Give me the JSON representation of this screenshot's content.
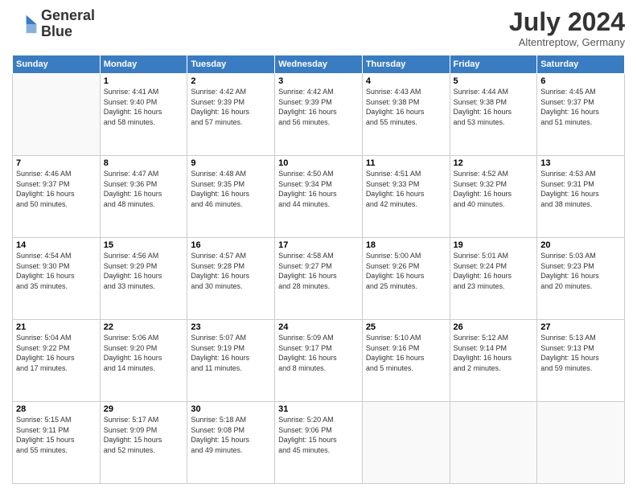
{
  "logo": {
    "line1": "General",
    "line2": "Blue"
  },
  "title": {
    "month_year": "July 2024",
    "location": "Altentreptow, Germany"
  },
  "weekdays": [
    "Sunday",
    "Monday",
    "Tuesday",
    "Wednesday",
    "Thursday",
    "Friday",
    "Saturday"
  ],
  "weeks": [
    [
      {
        "day": "",
        "info": ""
      },
      {
        "day": "1",
        "info": "Sunrise: 4:41 AM\nSunset: 9:40 PM\nDaylight: 16 hours\nand 58 minutes."
      },
      {
        "day": "2",
        "info": "Sunrise: 4:42 AM\nSunset: 9:39 PM\nDaylight: 16 hours\nand 57 minutes."
      },
      {
        "day": "3",
        "info": "Sunrise: 4:42 AM\nSunset: 9:39 PM\nDaylight: 16 hours\nand 56 minutes."
      },
      {
        "day": "4",
        "info": "Sunrise: 4:43 AM\nSunset: 9:38 PM\nDaylight: 16 hours\nand 55 minutes."
      },
      {
        "day": "5",
        "info": "Sunrise: 4:44 AM\nSunset: 9:38 PM\nDaylight: 16 hours\nand 53 minutes."
      },
      {
        "day": "6",
        "info": "Sunrise: 4:45 AM\nSunset: 9:37 PM\nDaylight: 16 hours\nand 51 minutes."
      }
    ],
    [
      {
        "day": "7",
        "info": "Sunrise: 4:46 AM\nSunset: 9:37 PM\nDaylight: 16 hours\nand 50 minutes."
      },
      {
        "day": "8",
        "info": "Sunrise: 4:47 AM\nSunset: 9:36 PM\nDaylight: 16 hours\nand 48 minutes."
      },
      {
        "day": "9",
        "info": "Sunrise: 4:48 AM\nSunset: 9:35 PM\nDaylight: 16 hours\nand 46 minutes."
      },
      {
        "day": "10",
        "info": "Sunrise: 4:50 AM\nSunset: 9:34 PM\nDaylight: 16 hours\nand 44 minutes."
      },
      {
        "day": "11",
        "info": "Sunrise: 4:51 AM\nSunset: 9:33 PM\nDaylight: 16 hours\nand 42 minutes."
      },
      {
        "day": "12",
        "info": "Sunrise: 4:52 AM\nSunset: 9:32 PM\nDaylight: 16 hours\nand 40 minutes."
      },
      {
        "day": "13",
        "info": "Sunrise: 4:53 AM\nSunset: 9:31 PM\nDaylight: 16 hours\nand 38 minutes."
      }
    ],
    [
      {
        "day": "14",
        "info": "Sunrise: 4:54 AM\nSunset: 9:30 PM\nDaylight: 16 hours\nand 35 minutes."
      },
      {
        "day": "15",
        "info": "Sunrise: 4:56 AM\nSunset: 9:29 PM\nDaylight: 16 hours\nand 33 minutes."
      },
      {
        "day": "16",
        "info": "Sunrise: 4:57 AM\nSunset: 9:28 PM\nDaylight: 16 hours\nand 30 minutes."
      },
      {
        "day": "17",
        "info": "Sunrise: 4:58 AM\nSunset: 9:27 PM\nDaylight: 16 hours\nand 28 minutes."
      },
      {
        "day": "18",
        "info": "Sunrise: 5:00 AM\nSunset: 9:26 PM\nDaylight: 16 hours\nand 25 minutes."
      },
      {
        "day": "19",
        "info": "Sunrise: 5:01 AM\nSunset: 9:24 PM\nDaylight: 16 hours\nand 23 minutes."
      },
      {
        "day": "20",
        "info": "Sunrise: 5:03 AM\nSunset: 9:23 PM\nDaylight: 16 hours\nand 20 minutes."
      }
    ],
    [
      {
        "day": "21",
        "info": "Sunrise: 5:04 AM\nSunset: 9:22 PM\nDaylight: 16 hours\nand 17 minutes."
      },
      {
        "day": "22",
        "info": "Sunrise: 5:06 AM\nSunset: 9:20 PM\nDaylight: 16 hours\nand 14 minutes."
      },
      {
        "day": "23",
        "info": "Sunrise: 5:07 AM\nSunset: 9:19 PM\nDaylight: 16 hours\nand 11 minutes."
      },
      {
        "day": "24",
        "info": "Sunrise: 5:09 AM\nSunset: 9:17 PM\nDaylight: 16 hours\nand 8 minutes."
      },
      {
        "day": "25",
        "info": "Sunrise: 5:10 AM\nSunset: 9:16 PM\nDaylight: 16 hours\nand 5 minutes."
      },
      {
        "day": "26",
        "info": "Sunrise: 5:12 AM\nSunset: 9:14 PM\nDaylight: 16 hours\nand 2 minutes."
      },
      {
        "day": "27",
        "info": "Sunrise: 5:13 AM\nSunset: 9:13 PM\nDaylight: 15 hours\nand 59 minutes."
      }
    ],
    [
      {
        "day": "28",
        "info": "Sunrise: 5:15 AM\nSunset: 9:11 PM\nDaylight: 15 hours\nand 55 minutes."
      },
      {
        "day": "29",
        "info": "Sunrise: 5:17 AM\nSunset: 9:09 PM\nDaylight: 15 hours\nand 52 minutes."
      },
      {
        "day": "30",
        "info": "Sunrise: 5:18 AM\nSunset: 9:08 PM\nDaylight: 15 hours\nand 49 minutes."
      },
      {
        "day": "31",
        "info": "Sunrise: 5:20 AM\nSunset: 9:06 PM\nDaylight: 15 hours\nand 45 minutes."
      },
      {
        "day": "",
        "info": ""
      },
      {
        "day": "",
        "info": ""
      },
      {
        "day": "",
        "info": ""
      }
    ]
  ]
}
